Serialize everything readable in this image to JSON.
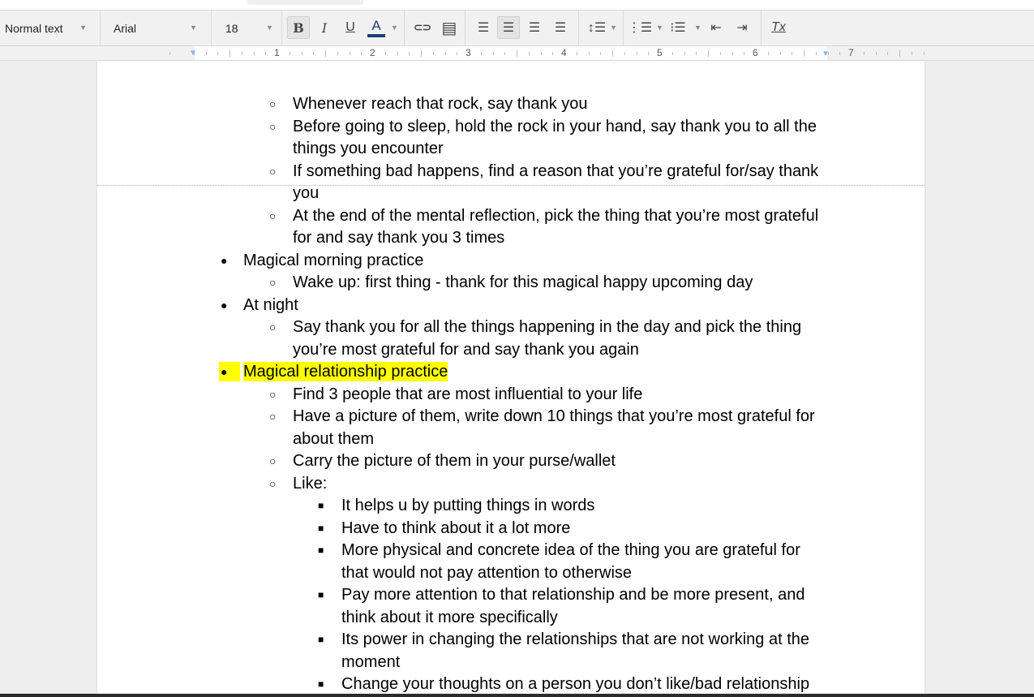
{
  "toolbar": {
    "style": "Normal text",
    "font": "Arial",
    "size": "18",
    "bold": "B",
    "italic": "I",
    "underline": "U",
    "text_color": "A",
    "text_color_value": "#1c3f7a",
    "link_icon": "⊂⊃",
    "comment_icon": "▤",
    "clear_format": "Tx"
  },
  "ruler": {
    "numbers": [
      "1",
      "2",
      "3",
      "4",
      "5",
      "6",
      "7"
    ]
  },
  "document": {
    "highlight_color": "#ffff00",
    "lines": [
      {
        "level": 2,
        "bullet": true,
        "text": "Whenever reach that rock, say thank you"
      },
      {
        "level": 2,
        "bullet": true,
        "text": "Before going to sleep, hold the rock in your hand, say thank you to all the"
      },
      {
        "level": 2,
        "bullet": false,
        "text": "things you encounter"
      },
      {
        "level": 2,
        "bullet": true,
        "text": "If something bad happens, find a reason that you’re grateful for/say thank"
      },
      {
        "level": 2,
        "bullet": false,
        "text": "you"
      },
      {
        "level": 2,
        "bullet": true,
        "text": "At the end of the mental reflection, pick the thing that you’re most grateful"
      },
      {
        "level": 2,
        "bullet": false,
        "text": "for and say thank you 3 times"
      },
      {
        "level": 1,
        "bullet": true,
        "text": "Magical morning practice"
      },
      {
        "level": 2,
        "bullet": true,
        "text": "Wake up: first thing - thank for this magical happy upcoming day"
      },
      {
        "level": 1,
        "bullet": true,
        "text": "At night"
      },
      {
        "level": 2,
        "bullet": true,
        "text": "Say thank you for all the things happening in the day and pick the thing"
      },
      {
        "level": 2,
        "bullet": false,
        "text": "you’re most grateful for and say thank you again"
      },
      {
        "level": 1,
        "bullet": true,
        "text": "Magical relationship practice",
        "highlight": true
      },
      {
        "level": 2,
        "bullet": true,
        "text": "Find 3 people that are most influential to your life"
      },
      {
        "level": 2,
        "bullet": true,
        "text": "Have a picture of them, write down 10 things that you’re most grateful for"
      },
      {
        "level": 2,
        "bullet": false,
        "text": "about them"
      },
      {
        "level": 2,
        "bullet": true,
        "text": "Carry the picture of them in your purse/wallet"
      },
      {
        "level": 2,
        "bullet": true,
        "text": "Like:"
      },
      {
        "level": 3,
        "bullet": true,
        "text": "It helps u by putting things in words"
      },
      {
        "level": 3,
        "bullet": true,
        "text": "Have to think about it a lot more"
      },
      {
        "level": 3,
        "bullet": true,
        "text": "More physical and concrete idea of the thing you are grateful for"
      },
      {
        "level": 3,
        "bullet": false,
        "text": "that would not pay attention to otherwise"
      },
      {
        "level": 3,
        "bullet": true,
        "text": "Pay more attention to that relationship and be more present, and"
      },
      {
        "level": 3,
        "bullet": false,
        "text": "think about it more specifically"
      },
      {
        "level": 3,
        "bullet": true,
        "text": "Its power in changing the relationships that are not working at the"
      },
      {
        "level": 3,
        "bullet": false,
        "text": "moment"
      },
      {
        "level": 3,
        "bullet": true,
        "text": "Change your thoughts on a person you don’t like/bad relationship"
      }
    ]
  }
}
